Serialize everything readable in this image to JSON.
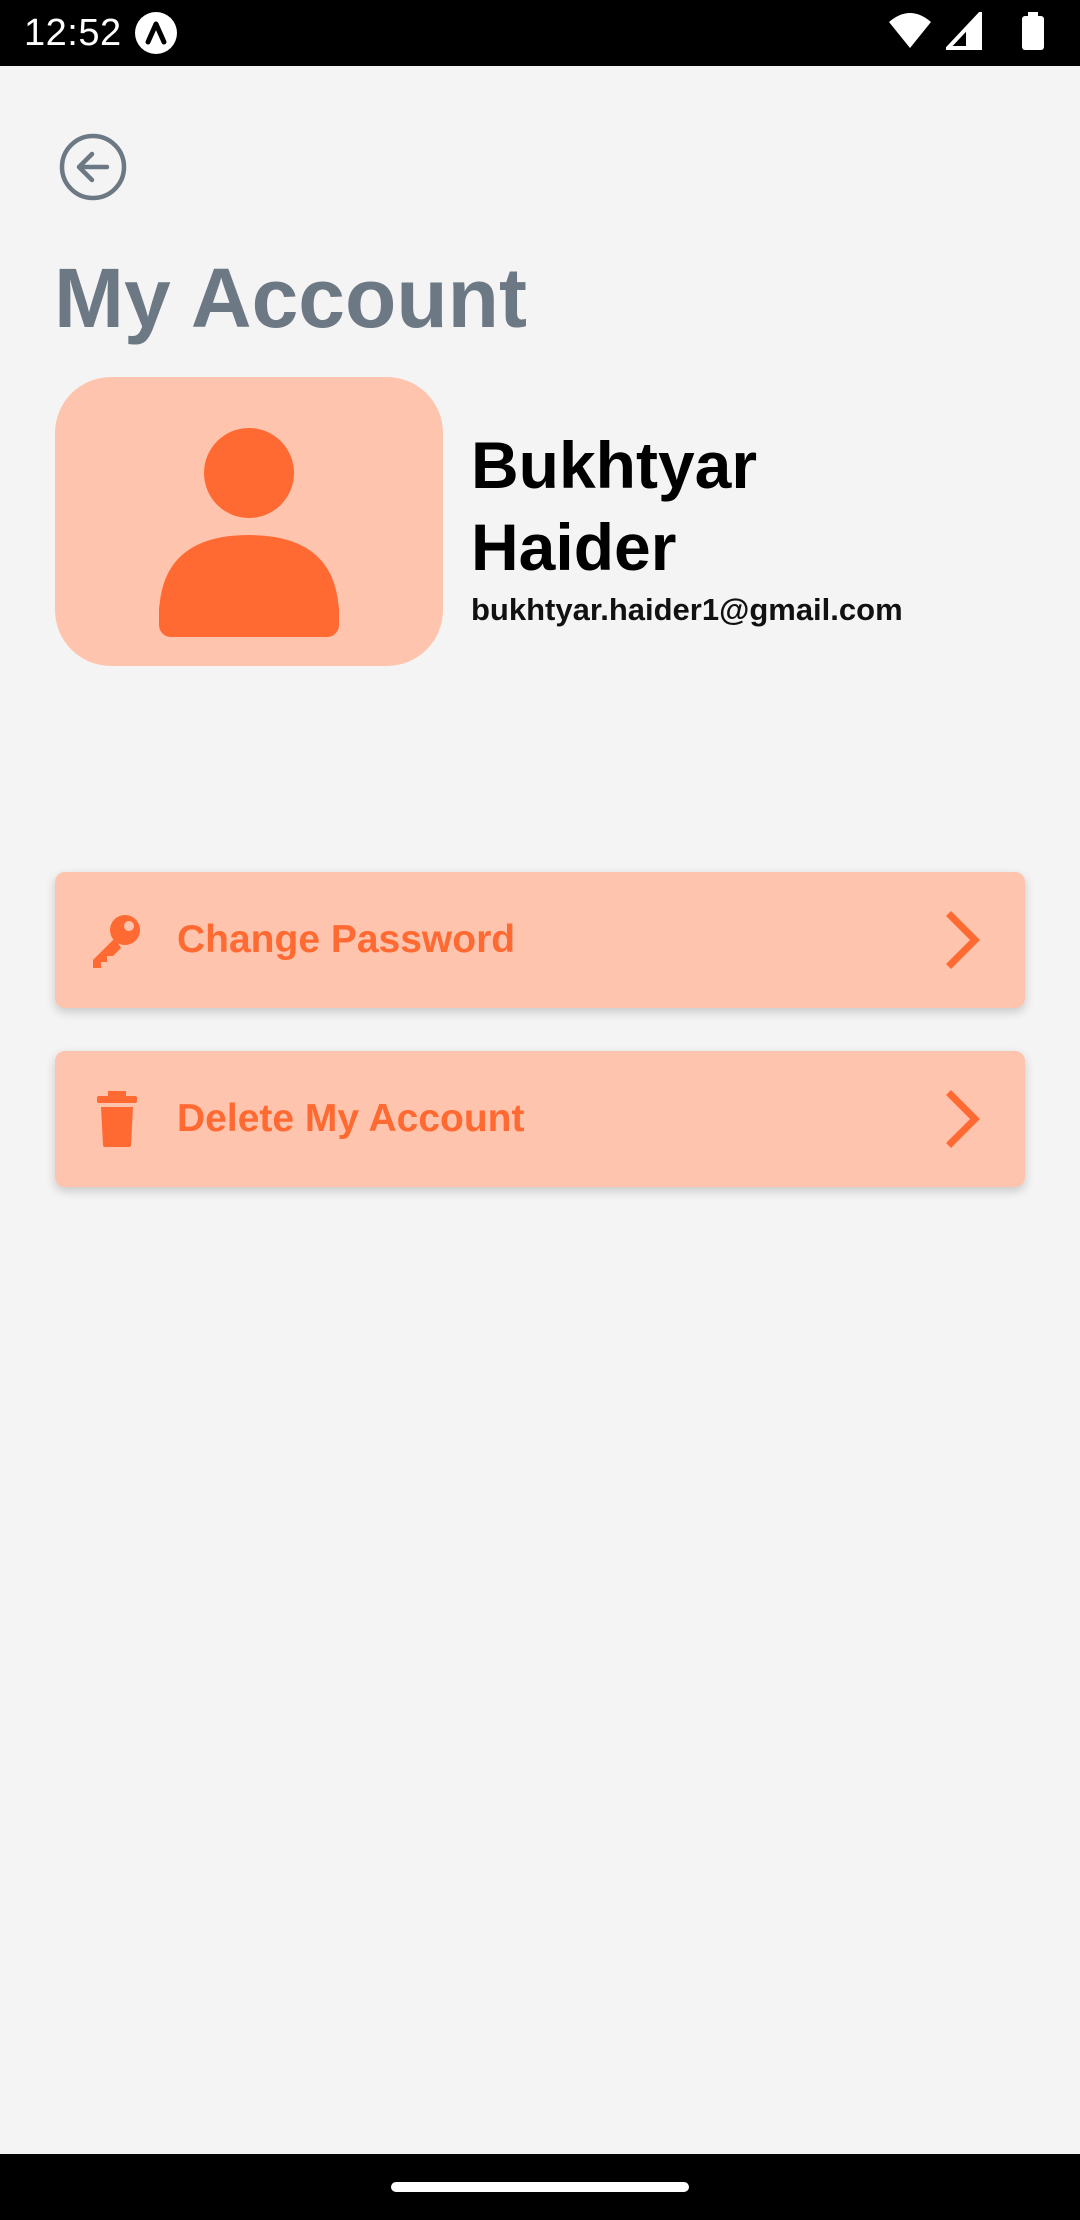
{
  "status_bar": {
    "time": "12:52",
    "app_icon": "app-notification-icon",
    "icons": [
      "wifi-icon",
      "signal-icon",
      "battery-icon"
    ]
  },
  "header": {
    "back_icon": "arrow-left-circle-icon",
    "title": "My Account"
  },
  "profile": {
    "avatar_icon": "person-icon",
    "first_name": "Bukhtyar",
    "last_name": "Haider",
    "email": "bukhtyar.haider1@gmail.com"
  },
  "menu": [
    {
      "icon": "key-icon",
      "label": "Change Password",
      "chevron": "chevron-right-icon"
    },
    {
      "icon": "trash-icon",
      "label": "Delete My Account",
      "chevron": "chevron-right-icon"
    }
  ],
  "colors": {
    "background": "#f4f4f4",
    "accent": "#ff6a33",
    "card_background": "#ffc4ad",
    "title": "#6c7883"
  }
}
